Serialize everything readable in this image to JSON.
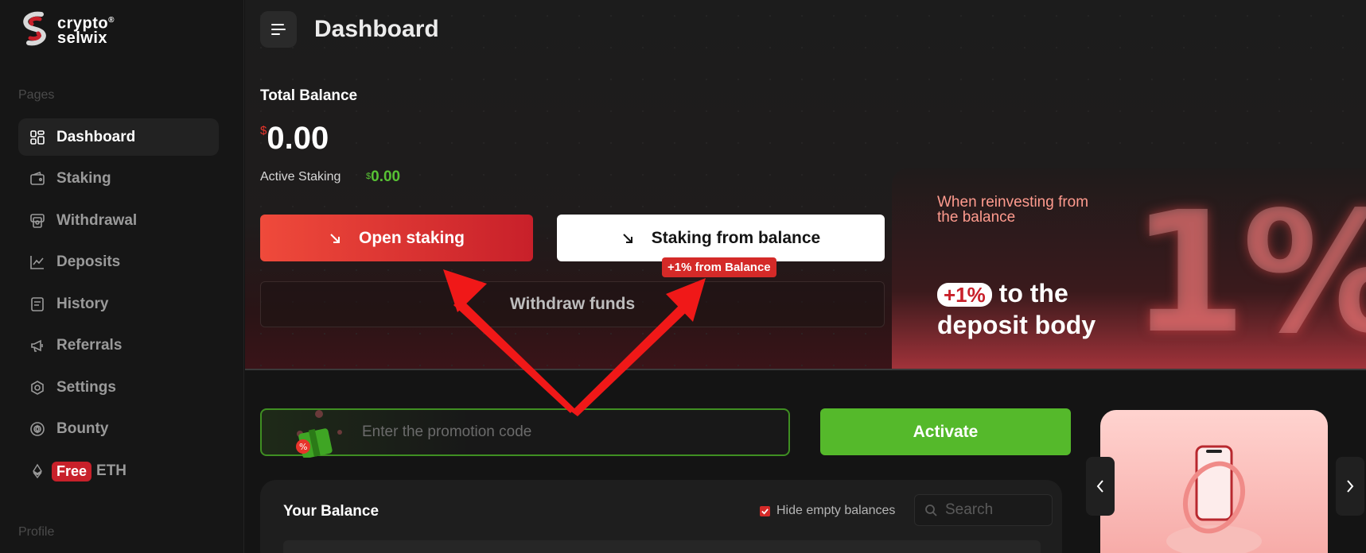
{
  "brand": {
    "line1": "crypto",
    "line2": "selwix",
    "mark": "®"
  },
  "sidebar": {
    "pages_label": "Pages",
    "profile_label": "Profile",
    "items": [
      {
        "label": "Dashboard",
        "icon": "dashboard-icon",
        "active": true
      },
      {
        "label": "Staking",
        "icon": "wallet-icon"
      },
      {
        "label": "Withdrawal",
        "icon": "withdraw-icon"
      },
      {
        "label": "Deposits",
        "icon": "chart-icon"
      },
      {
        "label": "History",
        "icon": "history-icon"
      },
      {
        "label": "Referrals",
        "icon": "megaphone-icon"
      },
      {
        "label": "Settings",
        "icon": "settings-icon"
      },
      {
        "label": "Bounty",
        "icon": "bounty-icon"
      }
    ],
    "free_eth": {
      "badge": "Free",
      "label": "ETH",
      "icon": "eth-icon"
    }
  },
  "header": {
    "title": "Dashboard"
  },
  "balance": {
    "total_label": "Total Balance",
    "currency": "$",
    "total_value": "0.00",
    "active_staking_label": "Active Staking",
    "active_staking_value": "0.00"
  },
  "actions": {
    "open_staking": "Open staking",
    "staking_from_balance": "Staking from balance",
    "bonus_tag": "+1% from Balance",
    "withdraw_funds": "Withdraw funds"
  },
  "promo_banner": {
    "subtitle": "When reinvesting from the balance",
    "pill": "+1%",
    "headline_rest": "to the",
    "headline_line2": "deposit body",
    "big_text": "1%"
  },
  "promotion": {
    "placeholder": "Enter the promotion code",
    "activate_label": "Activate"
  },
  "your_balance": {
    "title": "Your Balance",
    "hide_empty_label": "Hide empty balances",
    "hide_empty_checked": true,
    "search_placeholder": "Search"
  },
  "colors": {
    "accent_red": "#d42a28",
    "accent_green": "#55b92b",
    "background": "#141414"
  }
}
